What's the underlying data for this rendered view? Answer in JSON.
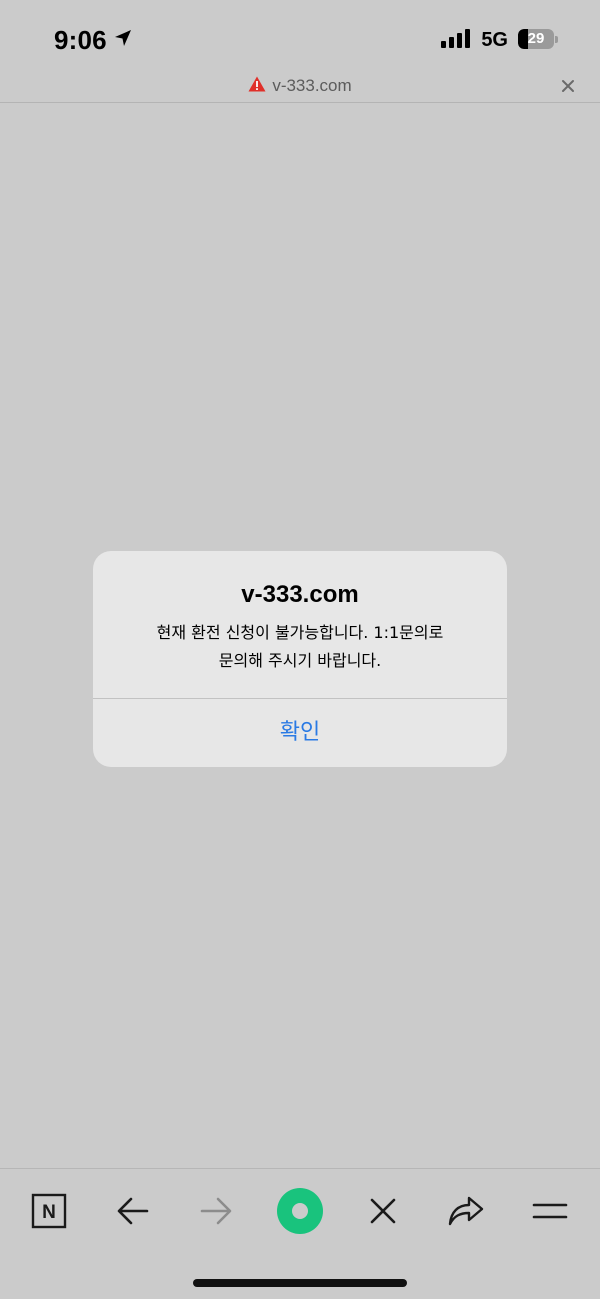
{
  "status_bar": {
    "time": "9:06",
    "network": "5G",
    "battery_percent": "29",
    "battery_level": 0.29,
    "icons": [
      "location-arrow-icon",
      "signal-bars-icon",
      "battery-icon"
    ]
  },
  "url_bar": {
    "url": "v-333.com",
    "warning_icon": "warning-triangle-icon",
    "close_icon": "close-icon",
    "warning_color": "#e0302a"
  },
  "alert": {
    "title": "v-333.com",
    "message_line1": "현재 환전 신청이 불가능합니다. 1:1문의로",
    "message_line2": "문의해 주시기 바랍니다.",
    "confirm_label": "확인",
    "accent_color": "#2a7ae4"
  },
  "toolbar": {
    "items": [
      "naver-logo-icon",
      "back-arrow-icon",
      "forward-arrow-icon",
      "green-dot-icon",
      "close-x-icon",
      "share-icon",
      "menu-icon"
    ],
    "naver_letter": "N",
    "green_color": "#19c37d"
  }
}
